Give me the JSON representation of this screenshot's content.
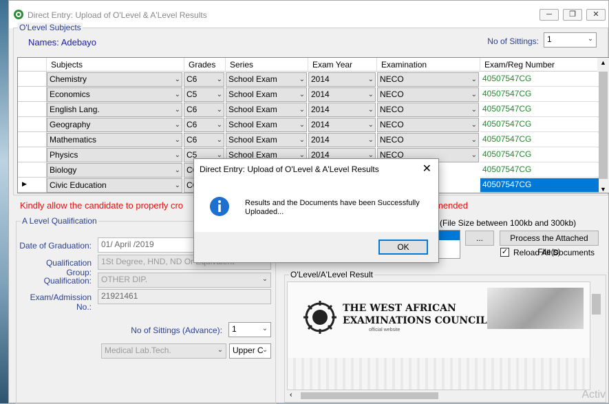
{
  "window": {
    "title": "Direct Entry: Upload of O'Level & A'Level Results"
  },
  "olevel": {
    "group_title": "O'Level Subjects",
    "names_label": "Names:",
    "names_value": "Adebayo",
    "sittings_label": "No of Sittings:",
    "sittings_value": "1",
    "columns": [
      "Subjects",
      "Grades",
      "Series",
      "Exam Year",
      "Examination",
      "Exam/Reg Number"
    ],
    "rows": [
      {
        "subject": "Chemistry",
        "grade": "C6",
        "series": "School Exam",
        "year": "2014",
        "exam": "NECO",
        "reg": "40507547CG"
      },
      {
        "subject": "Economics",
        "grade": "C5",
        "series": "School Exam",
        "year": "2014",
        "exam": "NECO",
        "reg": "40507547CG"
      },
      {
        "subject": "English Lang.",
        "grade": "C6",
        "series": "School Exam",
        "year": "2014",
        "exam": "NECO",
        "reg": "40507547CG"
      },
      {
        "subject": "Geography",
        "grade": "C6",
        "series": "School Exam",
        "year": "2014",
        "exam": "NECO",
        "reg": "40507547CG"
      },
      {
        "subject": "Mathematics",
        "grade": "C6",
        "series": "School Exam",
        "year": "2014",
        "exam": "NECO",
        "reg": "40507547CG"
      },
      {
        "subject": "Physics",
        "grade": "C5",
        "series": "School Exam",
        "year": "2014",
        "exam": "NECO",
        "reg": "40507547CG"
      },
      {
        "subject": "Biology",
        "grade": "C6",
        "series": "",
        "year": "",
        "exam": "",
        "reg": "40507547CG"
      },
      {
        "subject": "Civic Education",
        "grade": "C6",
        "series": "",
        "year": "",
        "exam": "",
        "reg": "40507547CG"
      }
    ]
  },
  "warning": {
    "left": "Kindly allow the candidate to properly cro",
    "right": "mended"
  },
  "alevel": {
    "group_title": "A Level Qualification",
    "graduation_label": "Date of Graduation:",
    "graduation_value": "01/    April    /2019",
    "qual_group_label": "Qualification Group:",
    "qual_group_value": "1St Degree, HND, ND Or Equivalent",
    "qualification_label": "Qualification:",
    "qualification_value": "OTHER DIP.",
    "admission_label": "Exam/Admission No.:",
    "admission_value": "21921461",
    "sittings_adv_label": "No of Sittings (Advance):",
    "sittings_adv_value": "1",
    "course_value": "Medical Lab.Tech.",
    "level_value": "Upper C"
  },
  "upload": {
    "file_size_note": "(File Size between 100kb and 300kb)",
    "browse_label": "...",
    "process_label": "Process the Attached File(s)",
    "reload_label": "Reload All Documents",
    "reload_checked": true,
    "result_group_title": "O'Level/A'Level Result",
    "doc_heading_1": "THE WEST AFRICAN",
    "doc_heading_2": "EXAMINATIONS COUNCIL",
    "doc_sub": "official website"
  },
  "dialog": {
    "title": "Direct Entry: Upload of O'Level & A'Level Results",
    "message": "Results and the Documents have been Successfully Uploaded...",
    "ok_label": "OK"
  },
  "watermark": "Activ"
}
